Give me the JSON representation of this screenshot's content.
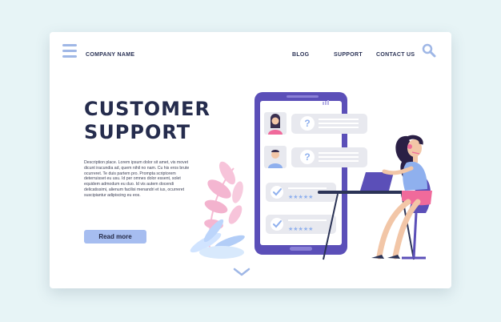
{
  "header": {
    "company_name": "COMPANY NAME",
    "nav": [
      "BLOG",
      "SUPPORT",
      "CONTACT US"
    ]
  },
  "hero": {
    "title_line1": "CUSTOMER",
    "title_line2": "SUPPORT",
    "description": "Description place.  Lorem ipsum dolor sit amet, vis movet dicunt iracundia ad, quem nihil no nam. Cu his eros brute ocurreret. Te duis partem pro. Prompta scriptorem deterruisset eu usu. Id per omnes dolor essent, solet equidem admodum eu duo. Id vis autem docendi delicatissimi, alienum facilisi menandri et ius, ocurreret suscipiantur adipiscing eu eos.",
    "button_label": "Read more"
  },
  "icons": {
    "menu": "hamburger-menu-icon",
    "search": "search-icon",
    "scroll": "chevron-down-icon"
  },
  "colors": {
    "accent": "#a6bdf0",
    "phone": "#5b4fb8",
    "heading": "#252c4d",
    "background": "#e7f4f6"
  }
}
